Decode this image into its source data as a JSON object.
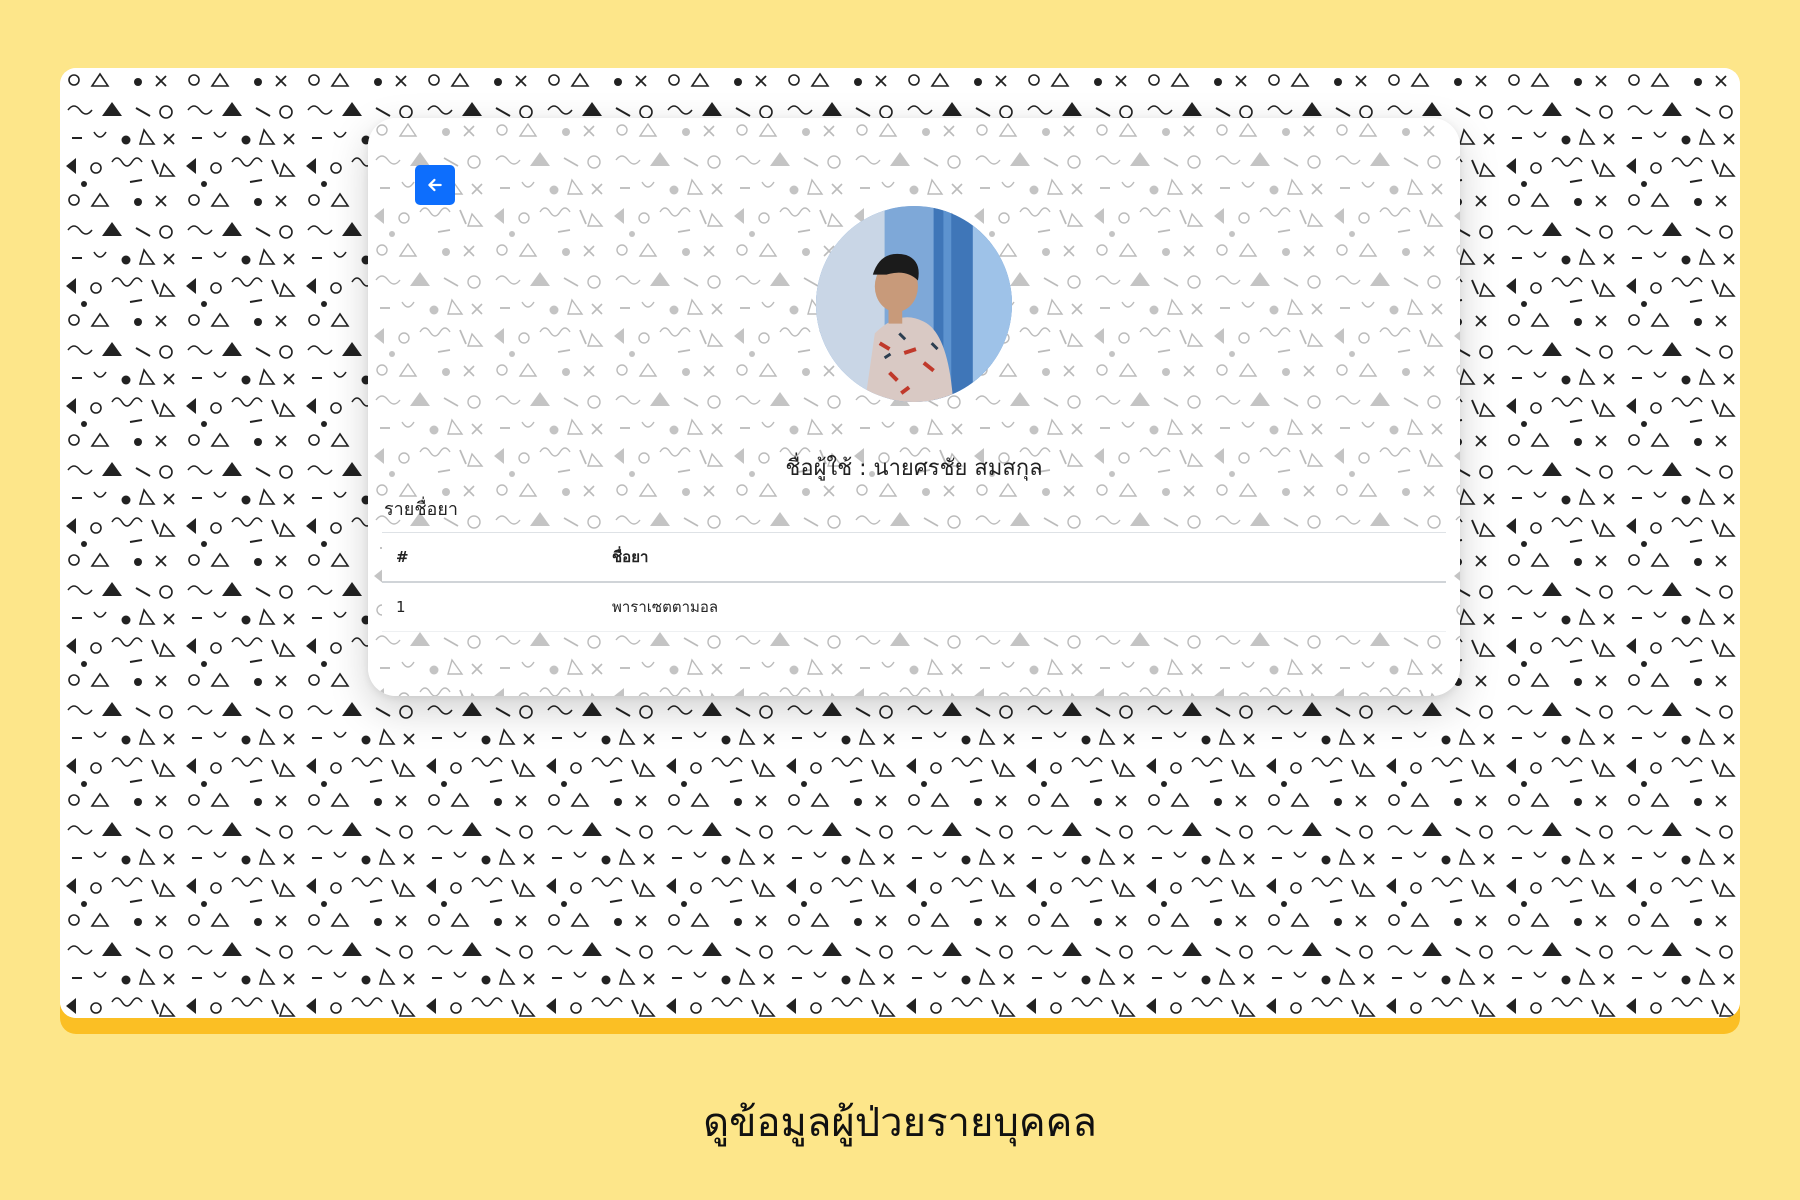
{
  "profile": {
    "user_name": "ชื่อผู้ใช้ : นายศรชัย สมสกุล",
    "avatar_description": "avatar"
  },
  "medications": {
    "section_title": "รายชื่อยา",
    "columns": [
      "#",
      "ชื่อยา"
    ],
    "rows": [
      {
        "num": "1",
        "name": "พาราเซตตามอล"
      }
    ]
  },
  "caption": "ดูข้อมูลผู้ป่วยรายบุคคล",
  "icons": {
    "back": "arrow-left-icon"
  },
  "colors": {
    "page_background": "#fde68a",
    "frame_accent": "#fbbf24",
    "primary_button": "#0d6efd"
  }
}
